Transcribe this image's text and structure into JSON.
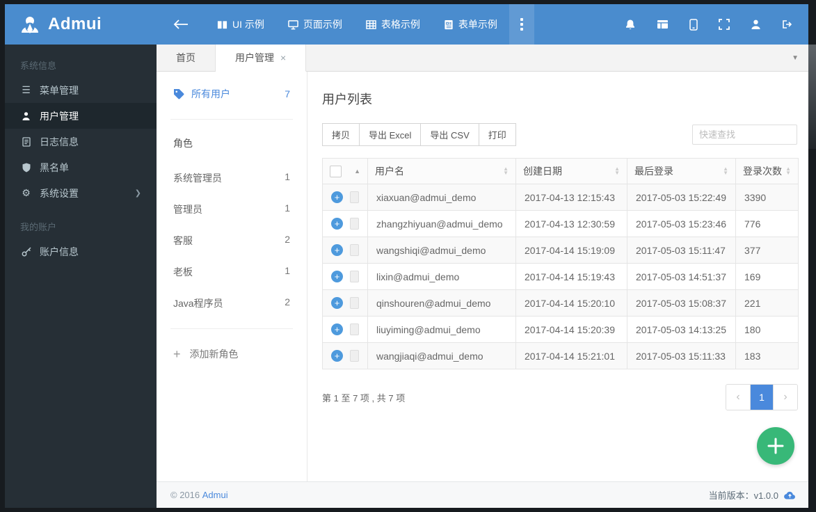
{
  "colors": {
    "accent": "#4a89dc",
    "navbar": "#4a8cce",
    "sidebar": "#262f36",
    "fab_green": "#38b878"
  },
  "navbar": {
    "brand": "Admui",
    "nav_items": [
      "UI 示例",
      "页面示例",
      "表格示例",
      "表单示例"
    ]
  },
  "sidebar": {
    "section1_label": "系统信息",
    "items": [
      {
        "label": "菜单管理"
      },
      {
        "label": "用户管理"
      },
      {
        "label": "日志信息"
      },
      {
        "label": "黑名单"
      },
      {
        "label": "系统设置"
      }
    ],
    "section2_label": "我的账户",
    "account_item": {
      "label": "账户信息"
    }
  },
  "tabs": {
    "home": "首页",
    "current": "用户管理",
    "close": "×"
  },
  "user_panel": {
    "all_users_label": "所有用户",
    "all_users_count": "7",
    "roles_header": "角色",
    "roles": [
      {
        "name": "系统管理员",
        "count": "1"
      },
      {
        "name": "管理员",
        "count": "1"
      },
      {
        "name": "客服",
        "count": "2"
      },
      {
        "name": "老板",
        "count": "1"
      },
      {
        "name": "Java程序员",
        "count": "2"
      }
    ],
    "add_role_label": "添加新角色"
  },
  "main": {
    "title": "用户列表",
    "toolbar": {
      "copy": "拷贝",
      "export_excel": "导出 Excel",
      "export_csv": "导出 CSV",
      "print": "打印",
      "search_placeholder": "快速查找"
    },
    "table": {
      "columns": [
        "用户名",
        "创建日期",
        "最后登录",
        "登录次数"
      ],
      "rows": [
        {
          "username": "xiaxuan@admui_demo",
          "created": "2017-04-13 12:15:43",
          "last_login": "2017-05-03 15:22:49",
          "logins": "3390"
        },
        {
          "username": "zhangzhiyuan@admui_demo",
          "created": "2017-04-13 12:30:59",
          "last_login": "2017-05-03 15:23:46",
          "logins": "776"
        },
        {
          "username": "wangshiqi@admui_demo",
          "created": "2017-04-14 15:19:09",
          "last_login": "2017-05-03 15:11:47",
          "logins": "377"
        },
        {
          "username": "lixin@admui_demo",
          "created": "2017-04-14 15:19:43",
          "last_login": "2017-05-03 14:51:37",
          "logins": "169"
        },
        {
          "username": "qinshouren@admui_demo",
          "created": "2017-04-14 15:20:10",
          "last_login": "2017-05-03 15:08:37",
          "logins": "221"
        },
        {
          "username": "liuyiming@admui_demo",
          "created": "2017-04-14 15:20:39",
          "last_login": "2017-05-03 14:13:25",
          "logins": "180"
        },
        {
          "username": "wangjiaqi@admui_demo",
          "created": "2017-04-14 15:21:01",
          "last_login": "2017-05-03 15:11:33",
          "logins": "183"
        }
      ]
    },
    "info": "第 1 至 7 项 , 共 7 项",
    "pagination": {
      "page": "1"
    }
  },
  "footer": {
    "copyright": "© 2016",
    "brand": "Admui",
    "version": "当前版本：v1.0.0"
  }
}
